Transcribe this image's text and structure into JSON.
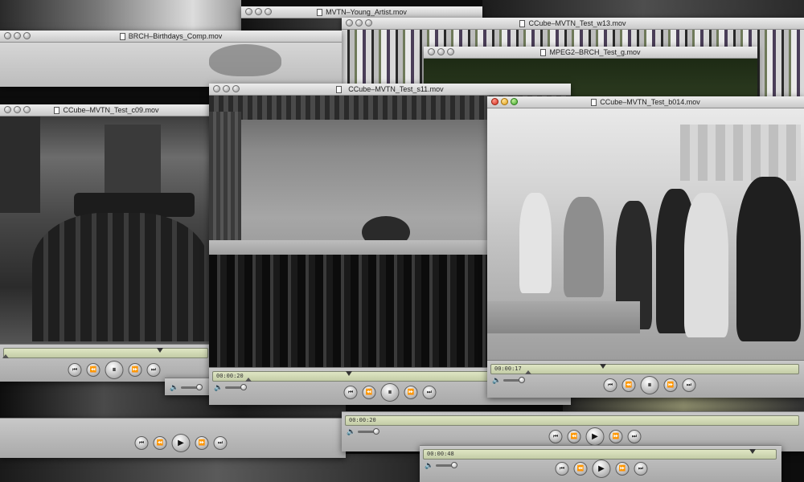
{
  "windows": {
    "w_young": {
      "title": "MVTN–Young_Artist.mov"
    },
    "w_w13": {
      "title": "CCube–MVTN_Test_w13.mov"
    },
    "w_mpeg": {
      "title": "MPEG2–BRCH_Test_g.mov"
    },
    "w_bday": {
      "title": "BRCH–Birthdays_Comp.mov"
    },
    "w_c09": {
      "title": "CCube–MVTN_Test_c09.mov"
    },
    "w_s11": {
      "title": "CCube–MVTN_Test_s11.mov",
      "timecode": "00:00:20"
    },
    "w_b014": {
      "title": "CCube–MVTN_Test_b014.mov",
      "timecode": "00:00:17"
    },
    "w_bottom1": {
      "timecode": "00:00:20"
    },
    "w_bottom2": {
      "timecode": "00:00:48"
    }
  },
  "icons": {
    "rewind_to_start": "⏮",
    "rewind": "⏪",
    "pause": "⏸",
    "play": "▶",
    "fast_forward": "⏩",
    "to_end": "⏭",
    "volume": "🔈"
  },
  "colors": {
    "close": "#d42e1e",
    "minimize": "#e0a217",
    "zoom": "#3fa82a",
    "timebar": "#cfd6b2"
  }
}
